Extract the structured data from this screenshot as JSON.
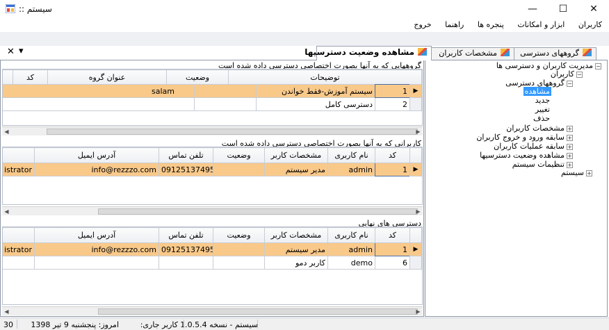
{
  "window": {
    "title": ":: سیستم",
    "minimize": "—",
    "maximize": "☐",
    "close": "✕"
  },
  "menu": [
    "کاربران",
    "ابزار و امکانات",
    "پنجره ها",
    "راهنما",
    "خروج"
  ],
  "tabs": [
    {
      "label": "گروههای دسترسی",
      "active": false
    },
    {
      "label": "مشخصات کاربران",
      "active": false
    },
    {
      "label": "مشاهده وضعیت دسترسیها",
      "active": true
    }
  ],
  "tab_controls": {
    "dropdown": "▾",
    "close": "✕"
  },
  "section1": {
    "title": "گروههایی که به آنها بصورت اختصاصی دسترسی داده شده است",
    "columns": [
      "کد",
      "عنوان گروه",
      "وضعیت",
      "توضیحات"
    ],
    "rows": [
      {
        "code": "1",
        "group_title": "سیستم آموزش-فقط خواندن",
        "status": "",
        "description": "salam",
        "current": true
      },
      {
        "code": "2",
        "group_title": "دسترسی کامل",
        "status": "",
        "description": "",
        "current": false
      }
    ]
  },
  "section2": {
    "title": "کاربرانی که به آنها بصورت اختصاصی دسترسی داده شده است",
    "columns": [
      "کد",
      "نام کاربری",
      "مشخصات کاربر",
      "وضعیت",
      "تلفن تماس",
      "آدرس ایمیل",
      ""
    ],
    "rows": [
      {
        "code": "1",
        "username": "admin",
        "user_info": "مدیر سیستم",
        "status": "",
        "phone": "09125137495",
        "email": "info@rezzzo.com",
        "extra": "istrator",
        "current": true
      }
    ]
  },
  "section3": {
    "title": "دسترسی های نهایی",
    "columns": [
      "کد",
      "نام کاربری",
      "مشخصات کاربر",
      "وضعیت",
      "تلفن تماس",
      "آدرس ایمیل",
      ""
    ],
    "rows": [
      {
        "code": "1",
        "username": "admin",
        "user_info": "مدیر سیستم",
        "status": "",
        "phone": "09125137495",
        "email": "info@rezzzo.com",
        "extra": "istrator",
        "current": true
      },
      {
        "code": "6",
        "username": "demo",
        "user_info": "کاربر دمو",
        "status": "",
        "phone": "",
        "email": "",
        "extra": "",
        "current": false
      }
    ]
  },
  "tree": {
    "root": "مدیریت کاربران و دسترسی ها",
    "users": "کاربران",
    "access_groups": "گروههای دسترسی",
    "view": "مشاهده",
    "new": "جدید",
    "change": "تغییر",
    "delete": "حذف",
    "user_profiles": "مشخصات کاربران",
    "login_history": "سابقه ورود و خروج کاربران",
    "operations_history": "سابقه عملیات کاربران",
    "access_status": "مشاهده وضعیت دسترسیها",
    "system_settings": "تنظیمات سیستم",
    "system": "سیستم"
  },
  "status": {
    "version": "سیستم - نسخه 1.0.5.4",
    "current_user": "کاربر جاری:",
    "today": "امروز: پنجشنبه 9 تیر 1398",
    "count": "30"
  }
}
